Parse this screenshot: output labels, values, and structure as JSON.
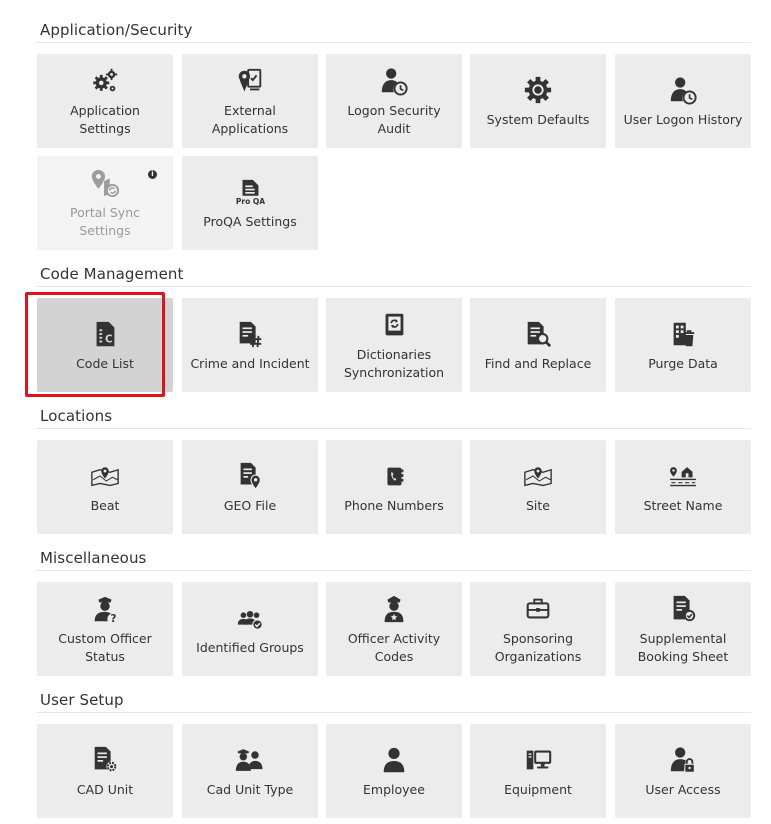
{
  "sections": [
    {
      "title": "Application/Security",
      "tiles": [
        {
          "label": "Application Settings",
          "icon": "gears-icon"
        },
        {
          "label": "External\nApplications",
          "icon": "external-app-icon"
        },
        {
          "label": "Logon Security Audit",
          "icon": "user-clock-icon"
        },
        {
          "label": "System Defaults",
          "icon": "gear-icon"
        },
        {
          "label": "User Logon History",
          "icon": "user-clock-icon"
        },
        {
          "label": "Portal Sync Settings",
          "icon": "map-sync-icon",
          "disabled": true,
          "info": "i"
        },
        {
          "label": "ProQA Settings",
          "icon": "proqa-doc-icon"
        }
      ]
    },
    {
      "title": "Code Management",
      "tiles": [
        {
          "label": "Code List",
          "icon": "code-list-icon",
          "selected": true
        },
        {
          "label": "Crime and Incident",
          "icon": "doc-hash-icon"
        },
        {
          "label": "Dictionaries\nSynchronization",
          "icon": "book-sync-icon"
        },
        {
          "label": "Find and Replace",
          "icon": "doc-search-icon"
        },
        {
          "label": "Purge Data",
          "icon": "building-trash-icon"
        }
      ]
    },
    {
      "title": "Locations",
      "tiles": [
        {
          "label": "Beat",
          "icon": "map-pin-icon"
        },
        {
          "label": "GEO File",
          "icon": "doc-pin-icon"
        },
        {
          "label": "Phone Numbers",
          "icon": "phone-book-icon"
        },
        {
          "label": "Site",
          "icon": "map-pin-icon"
        },
        {
          "label": "Street Name",
          "icon": "street-house-icon"
        }
      ]
    },
    {
      "title": "Miscellaneous",
      "tiles": [
        {
          "label": "Custom Officer\nStatus",
          "icon": "officer-question-icon"
        },
        {
          "label": "Identified Groups",
          "icon": "group-check-icon"
        },
        {
          "label": "Officer Activity\nCodes",
          "icon": "officer-icon"
        },
        {
          "label": "Sponsoring\nOrganizations",
          "icon": "briefcase-icon"
        },
        {
          "label": "Supplemental\nBooking Sheet",
          "icon": "doc-check-icon"
        }
      ]
    },
    {
      "title": "User Setup",
      "tiles": [
        {
          "label": "CAD Unit",
          "icon": "doc-gear-icon"
        },
        {
          "label": "Cad Unit Type",
          "icon": "officers-icon"
        },
        {
          "label": "Employee",
          "icon": "user-icon"
        },
        {
          "label": "Equipment",
          "icon": "computer-icon"
        },
        {
          "label": "User Access",
          "icon": "user-lock-icon"
        }
      ]
    }
  ]
}
